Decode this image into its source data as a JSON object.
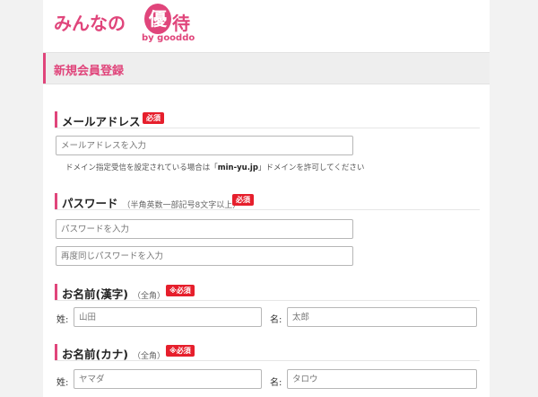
{
  "brand": {
    "logo_text": "みんなの",
    "logo_circle_char": "優",
    "logo_last_char": "待",
    "logo_sub": "by gooddo",
    "accent_color": "#e0457b",
    "badge_color": "#e61f2c"
  },
  "page_title": "新規会員登録",
  "email": {
    "label": "メールアドレス",
    "badge": "必須",
    "placeholder": "メールアドレスを入力",
    "hint_prefix": "ドメイン指定受信を設定されている場合は「",
    "hint_domain": "min-yu.jp",
    "hint_suffix": "」ドメインを許可してください"
  },
  "password": {
    "label": "パスワード",
    "note": "（半角英数一部記号8文字以上）",
    "badge": "必須",
    "placeholder": "パスワードを入力",
    "confirm_placeholder": "再度同じパスワードを入力"
  },
  "name_kanji": {
    "label": "お名前(漢字)",
    "note": "（全角）",
    "badge": "※必須",
    "last_label": "姓:",
    "last_placeholder": "山田",
    "first_label": "名:",
    "first_placeholder": "太郎"
  },
  "name_kana": {
    "label": "お名前(カナ)",
    "note": "（全角）",
    "badge": "※必須",
    "last_label": "姓:",
    "last_placeholder": "ヤマダ",
    "first_label": "名:",
    "first_placeholder": "タロウ"
  }
}
